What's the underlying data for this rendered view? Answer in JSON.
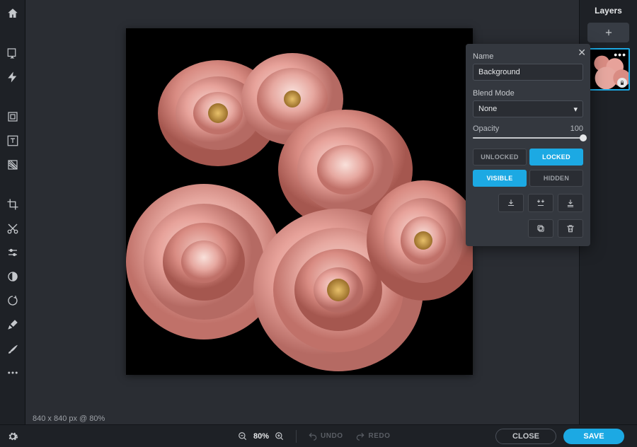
{
  "canvas": {
    "dimensions_label": "840 x 840 px @ 80%"
  },
  "zoom": {
    "percent": "80%"
  },
  "history": {
    "undo": "UNDO",
    "redo": "REDO"
  },
  "actions": {
    "close": "CLOSE",
    "save": "SAVE"
  },
  "layers_panel": {
    "title": "Layers"
  },
  "layer_props": {
    "name_label": "Name",
    "name_value": "Background",
    "blend_label": "Blend Mode",
    "blend_value": "None",
    "opacity_label": "Opacity",
    "opacity_value": "100",
    "unlocked": "UNLOCKED",
    "locked": "LOCKED",
    "visible": "VISIBLE",
    "hidden": "HIDDEN"
  }
}
